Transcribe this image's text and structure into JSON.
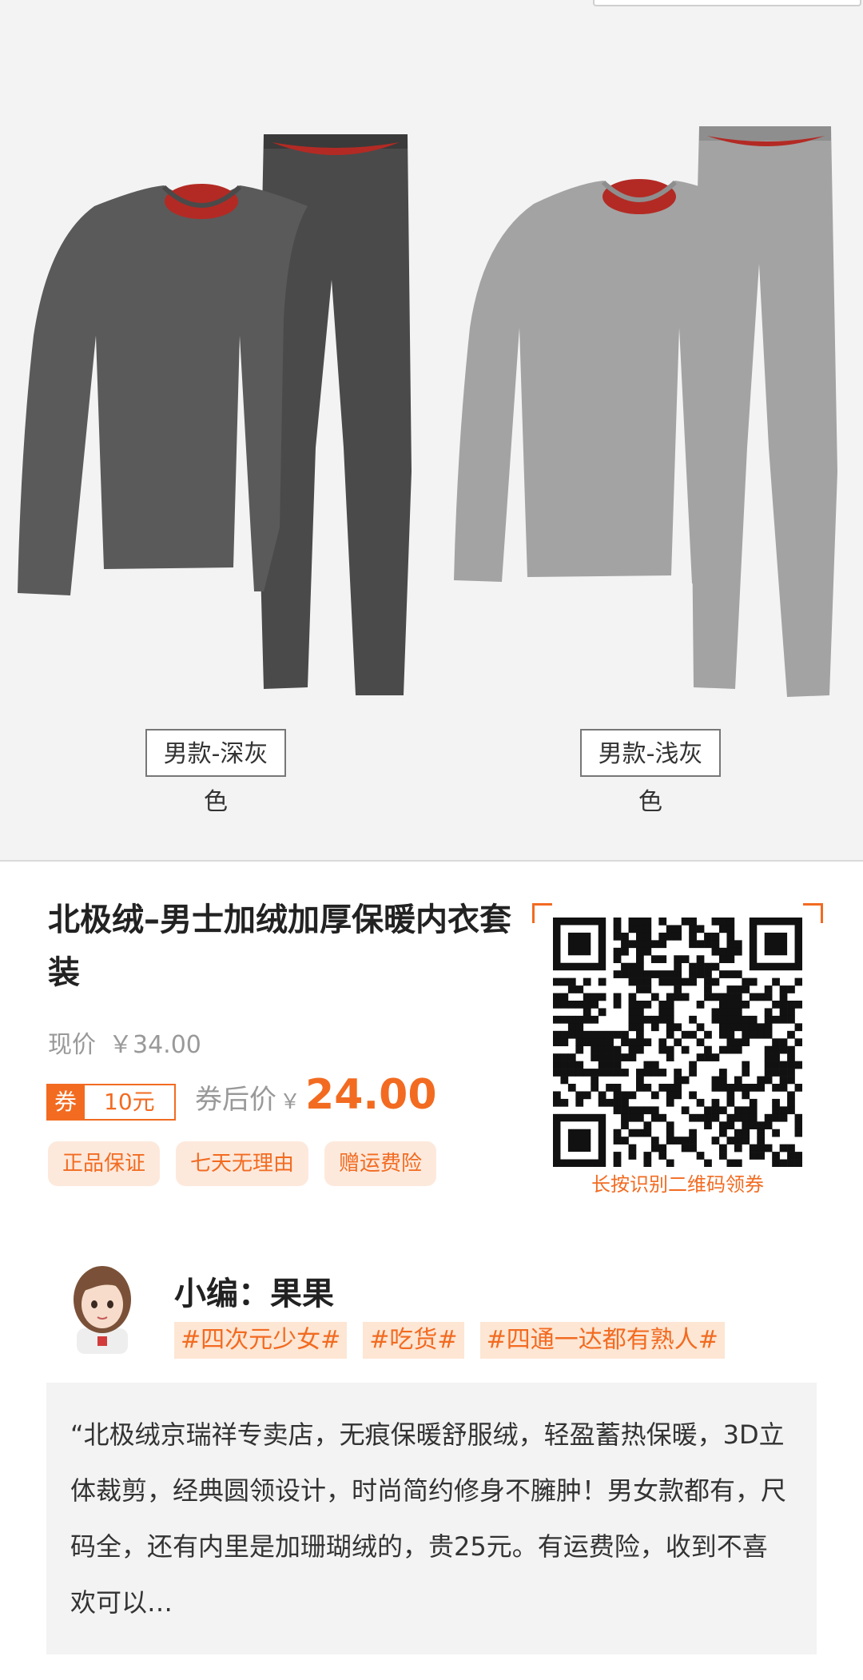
{
  "variants": [
    {
      "label": "男款-深灰色",
      "color": "#5a5a5a"
    },
    {
      "label": "男款-浅灰色",
      "color": "#a3a3a3"
    }
  ],
  "lining_color": "#b32a24",
  "product": {
    "title": "北极绒–男士加绒加厚保暖内衣套装",
    "current_price_label": "现价",
    "current_price": "￥34.00",
    "coupon_tag": "券",
    "coupon_amount": "10元",
    "after_coupon_label": "券后价",
    "after_coupon_currency": "￥",
    "after_coupon_price": "24.00",
    "badges": [
      "正品保证",
      "七天无理由",
      "赠运费险"
    ]
  },
  "qr": {
    "caption": "长按识别二维码领券",
    "icon": "qr-code-icon"
  },
  "editor": {
    "name": "小编：果果",
    "avatar_icon": "editor-avatar-icon",
    "tags": [
      "#四次元少女#",
      "#吃货#",
      "#四通一达都有熟人#"
    ],
    "quote": "“北极绒京瑞祥专卖店，无痕保暖舒服绒，轻盈蓄热保暖，3D立体裁剪，经典圆领设计，时尚简约修身不臃肿！男女款都有，尺码全，还有内里是加珊瑚绒的，贵25元。有运费险，收到不喜欢可以…"
  },
  "accent_color": "#f26b21"
}
